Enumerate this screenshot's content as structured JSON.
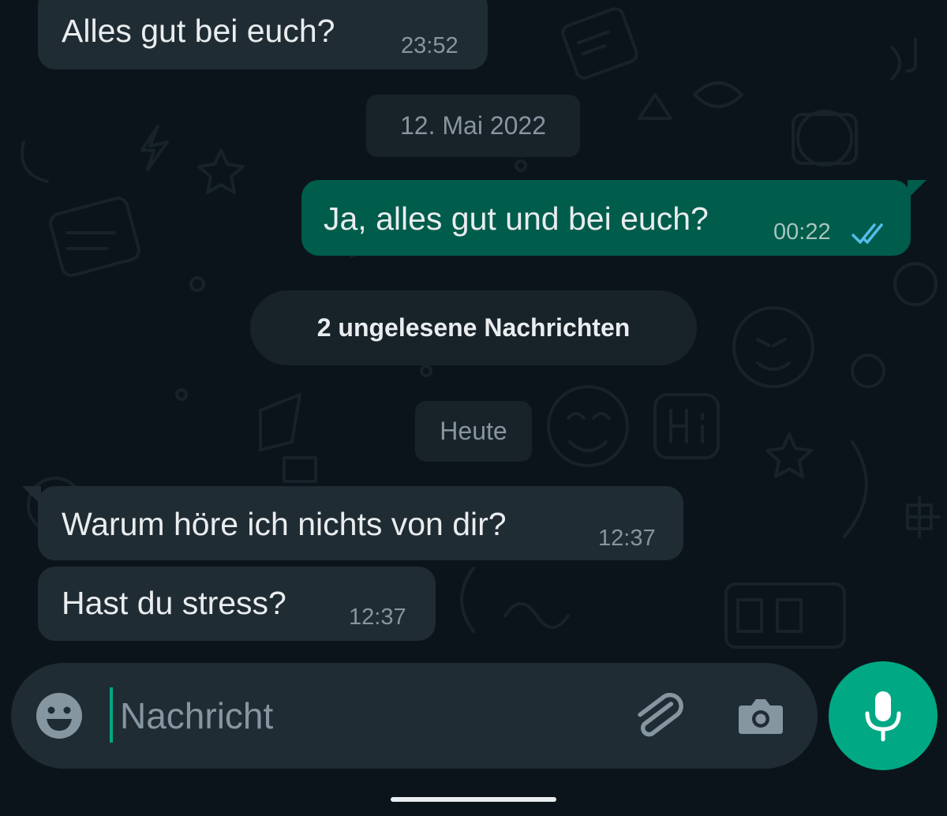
{
  "messages": [
    {
      "text": "Alles gut bei euch?",
      "time": "23:52",
      "direction": "incoming"
    },
    {
      "text": "Ja, alles gut und bei euch?",
      "time": "00:22",
      "direction": "outgoing",
      "status": "read"
    },
    {
      "text": "Warum höre ich nichts von dir?",
      "time": "12:37",
      "direction": "incoming"
    },
    {
      "text": "Hast du stress?",
      "time": "12:37",
      "direction": "incoming"
    }
  ],
  "date_separators": {
    "first": "12. Mai 2022",
    "second": "Heute"
  },
  "unread_banner": "2 ungelesene Nachrichten",
  "composer": {
    "placeholder": "Nachricht",
    "emoji_icon": "emoji-icon",
    "attach_icon": "paperclip-icon",
    "camera_icon": "camera-icon",
    "send_icon": "microphone-icon"
  },
  "colors": {
    "background": "#0b141a",
    "incoming_bubble": "#202c33",
    "outgoing_bubble": "#005c4b",
    "accent": "#00a884",
    "read_ticks": "#53bdeb"
  }
}
